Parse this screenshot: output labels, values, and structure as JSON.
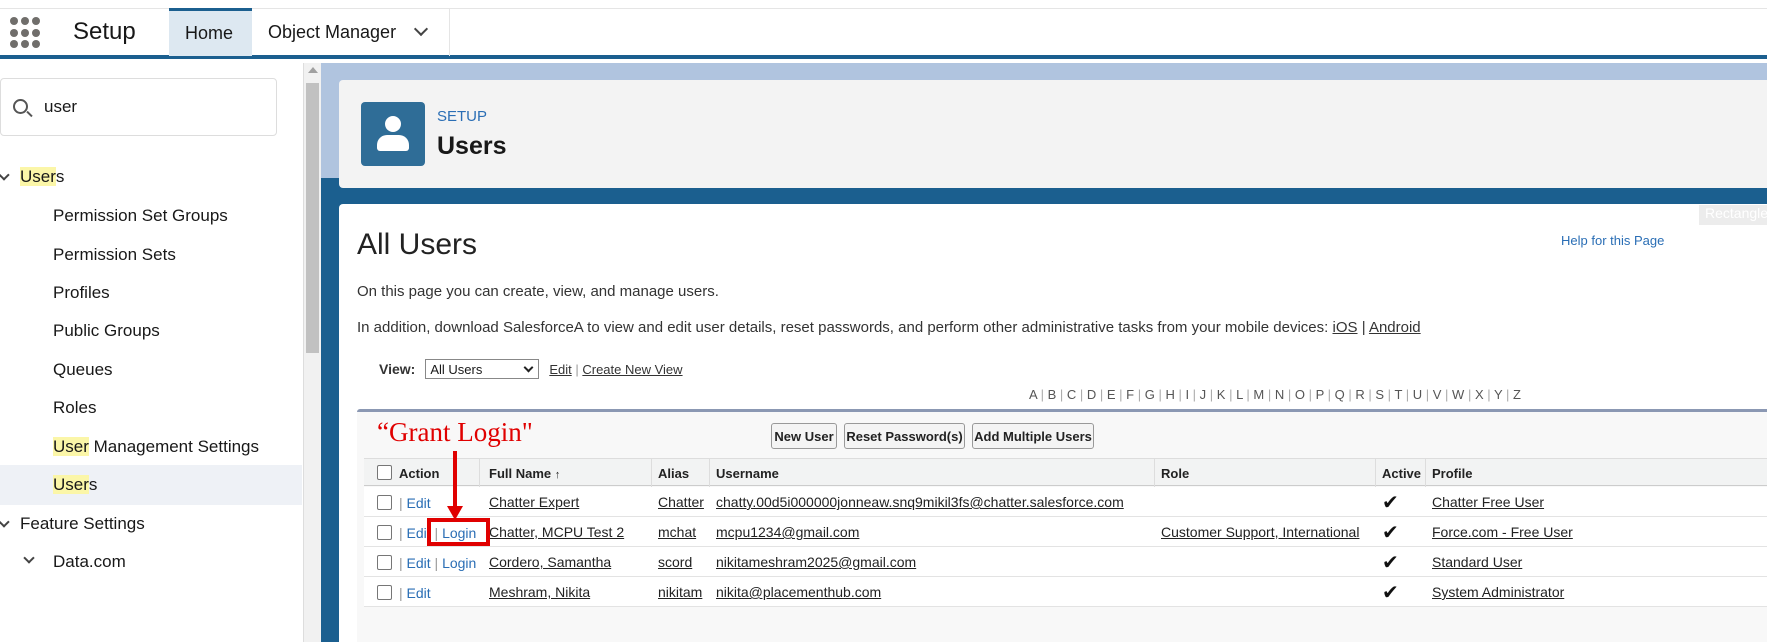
{
  "header": {
    "app_name": "Setup",
    "tabs": [
      {
        "label": "Home"
      },
      {
        "label": "Object Manager"
      }
    ]
  },
  "sidebar": {
    "search_value": "user",
    "items": [
      {
        "label_highlight": "User",
        "label_rest": "s"
      },
      {
        "label": "Permission Set Groups"
      },
      {
        "label": "Permission Sets"
      },
      {
        "label": "Profiles"
      },
      {
        "label": "Public Groups"
      },
      {
        "label": "Queues"
      },
      {
        "label": "Roles"
      },
      {
        "label_highlight": "User",
        "label_rest": " Management Settings"
      },
      {
        "label_highlight": "User",
        "label_rest": "s"
      },
      {
        "label": "Feature Settings"
      },
      {
        "label": "Data.com"
      }
    ]
  },
  "page": {
    "setup_label": "SETUP",
    "title": "Users",
    "corner_label": "Rectangle",
    "help_link": "Help for this Page",
    "heading": "All Users",
    "desc1": "On this page you can create, view, and manage users.",
    "desc2": "In addition, download SalesforceA to view and edit user details, reset passwords, and perform other administrative tasks from your mobile devices:",
    "ios": "iOS",
    "sep": "|",
    "android": "Android",
    "view_label": "View:",
    "view_value": "All Users",
    "view_edit": "Edit",
    "create_view": "Create New View",
    "alphabet": [
      "A",
      "B",
      "C",
      "D",
      "E",
      "F",
      "G",
      "H",
      "I",
      "J",
      "K",
      "L",
      "M",
      "N",
      "O",
      "P",
      "Q",
      "R",
      "S",
      "T",
      "U",
      "V",
      "W",
      "X",
      "Y",
      "Z"
    ]
  },
  "annotation": {
    "text": "“Grant Login\""
  },
  "buttons": {
    "new_user": "New User",
    "reset_password": "Reset Password(s)",
    "add_multiple": "Add Multiple Users"
  },
  "table": {
    "headers": {
      "action": "Action",
      "full_name": "Full Name",
      "sort": "↑",
      "alias": "Alias",
      "username": "Username",
      "role": "Role",
      "active": "Active",
      "profile": "Profile"
    },
    "edit_label": "Edit",
    "login_label": "Login",
    "rows": [
      {
        "full_name": "Chatter Expert",
        "alias": "Chatter",
        "username": "chatty.00d5i000000jonneaw.snq9mikil3fs@chatter.salesforce.com",
        "role": "",
        "active": "✔",
        "profile": "Chatter Free User"
      },
      {
        "full_name": "Chatter, MCPU Test 2",
        "alias": "mchat",
        "username": "mcpu1234@gmail.com",
        "role": "Customer Support, International",
        "active": "✔",
        "profile": "Force.com - Free User"
      },
      {
        "full_name": "Cordero, Samantha",
        "alias": "scord",
        "username": "nikitameshram2025@gmail.com",
        "role": "",
        "active": "✔",
        "profile": "Standard User"
      },
      {
        "full_name": "Meshram, Nikita",
        "alias": "nikitam",
        "username": "nikita@placementhub.com",
        "role": "",
        "active": "✔",
        "profile": "System Administrator"
      }
    ]
  }
}
